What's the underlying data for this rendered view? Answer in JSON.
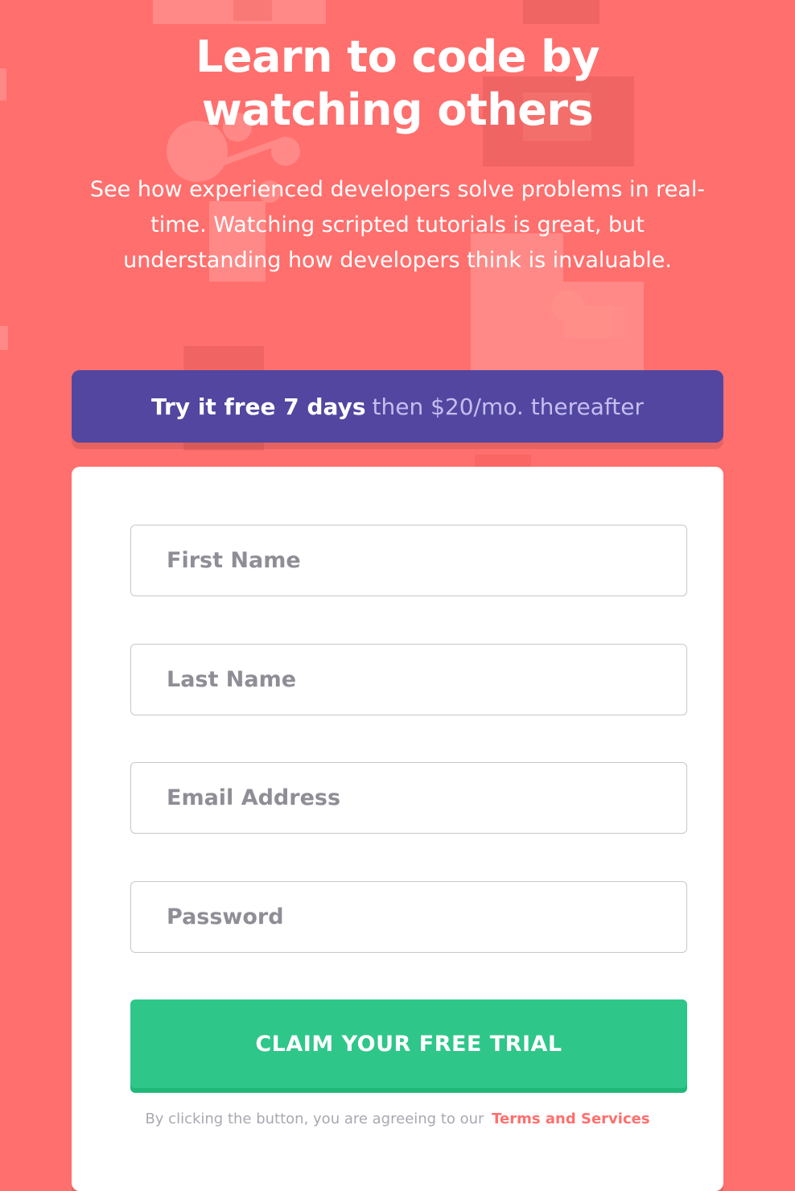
{
  "hero": {
    "title": "Learn to code by watching others",
    "description": "See how experienced developers solve problems in real-time. Watching scripted tutorials is great, but understanding how developers think is invaluable."
  },
  "offer": {
    "highlight": "Try it free 7 days",
    "rest": "then $20/mo. thereafter"
  },
  "form": {
    "first_name": {
      "placeholder": "First Name",
      "value": ""
    },
    "last_name": {
      "placeholder": "Last Name",
      "value": ""
    },
    "email": {
      "placeholder": "Email Address",
      "value": ""
    },
    "password": {
      "placeholder": "Password",
      "value": ""
    },
    "submit_label": "CLAIM YOUR FREE TRIAL",
    "terms_text": "By clicking the button, you are agreeing to our",
    "terms_link": "Terms and Services"
  },
  "colors": {
    "background": "#ff6f6d",
    "offer_bar": "#5246a0",
    "button": "#2fc68a",
    "link": "#ff6f6d"
  }
}
